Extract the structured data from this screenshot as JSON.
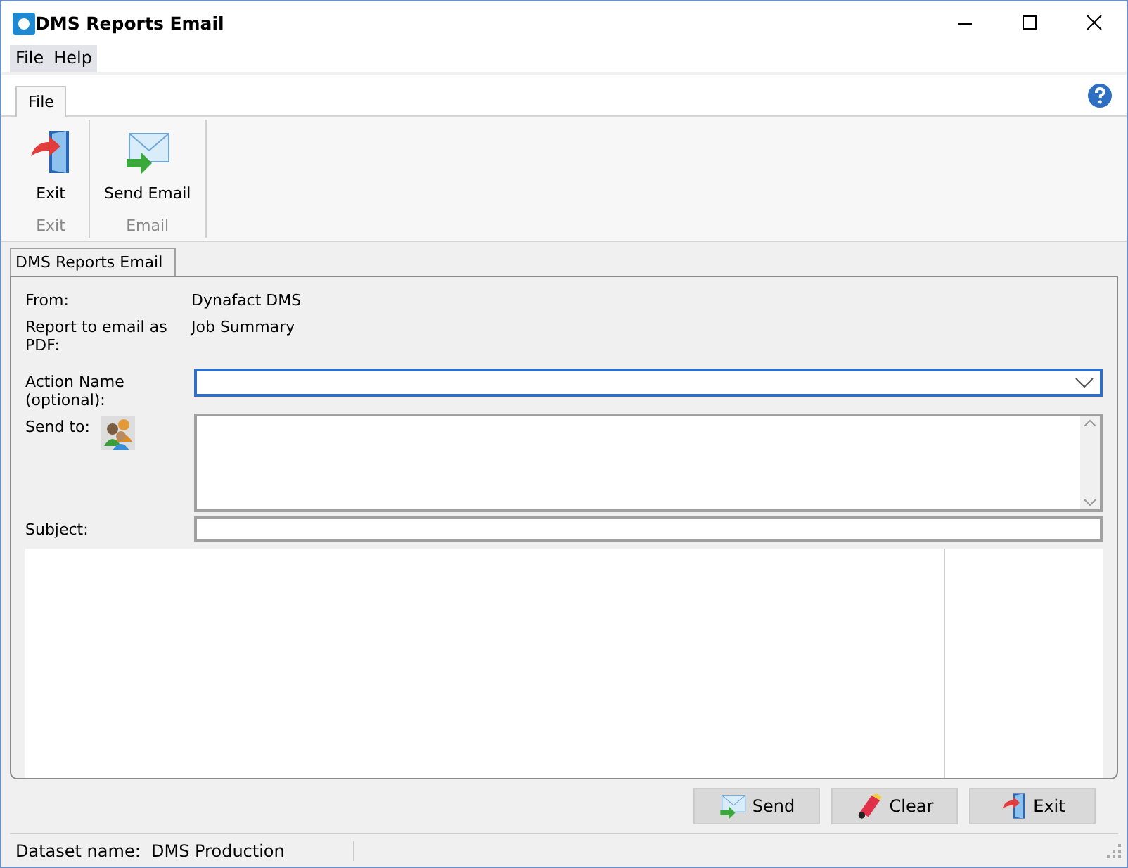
{
  "window": {
    "title": "DMS Reports Email"
  },
  "menu": [
    {
      "label": "File"
    },
    {
      "label": "Help"
    }
  ],
  "ribbon": {
    "tabs": [
      {
        "label": "File",
        "selected": true
      }
    ],
    "groups": [
      {
        "label": "Exit",
        "buttons": [
          {
            "label": "Exit",
            "kind": "exit"
          }
        ]
      },
      {
        "label": "Email",
        "buttons": [
          {
            "label": "Send Email",
            "kind": "email"
          }
        ]
      }
    ]
  },
  "document_tabs": [
    {
      "label": "DMS Reports Email",
      "selected": true
    }
  ],
  "form": {
    "info": [
      {
        "label": "From:",
        "value": "Dynafact DMS"
      },
      {
        "label": "Report to email as PDF:",
        "value": "Job Summary"
      }
    ],
    "action_name": {
      "label": "Action Name (optional):",
      "focused": true
    },
    "send_to": {
      "label": "Send to:"
    },
    "subject": {
      "label": "Subject:"
    }
  },
  "buttons": [
    {
      "label": "Send",
      "kind": "send"
    },
    {
      "label": "Clear",
      "kind": "clear"
    },
    {
      "label": "Exit",
      "kind": "exit"
    }
  ],
  "status_bar": {
    "label": "Dataset name:",
    "value": "DMS Production"
  }
}
